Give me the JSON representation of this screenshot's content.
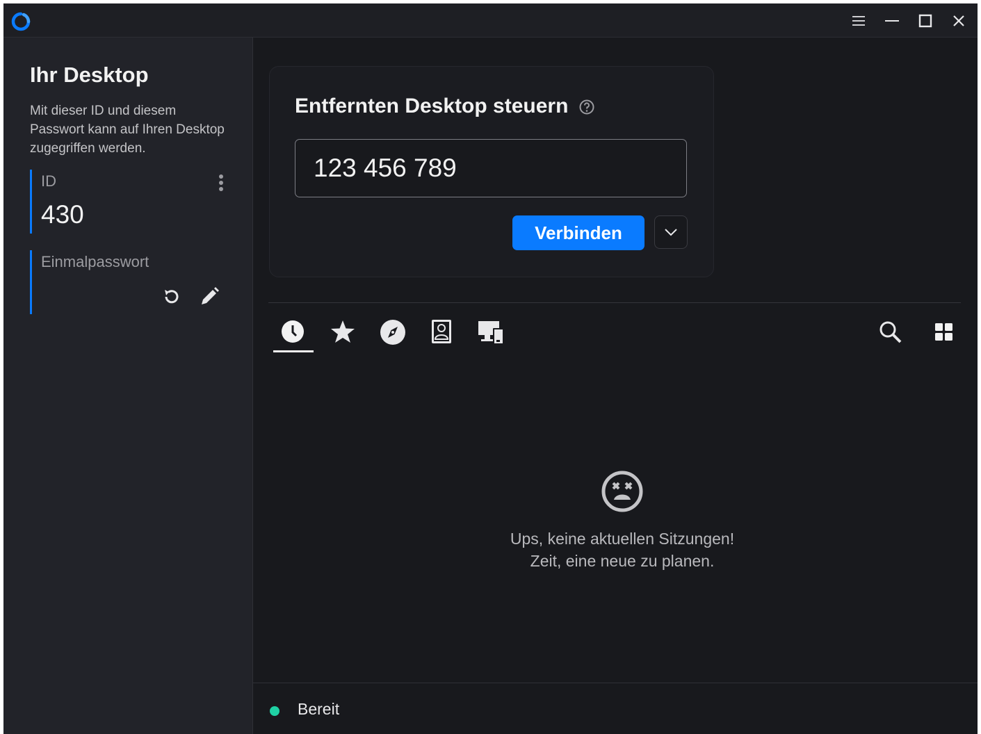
{
  "colors": {
    "accent": "#0a7bff",
    "status_ready": "#1fd1a4",
    "background": "#18191d",
    "sidebar": "#222329"
  },
  "titlebar": {
    "icons": [
      "app-logo-icon",
      "menu-icon",
      "minimize-icon",
      "maximize-icon",
      "close-icon"
    ]
  },
  "sidebar": {
    "title": "Ihr Desktop",
    "description": "Mit dieser ID und diesem Passwort kann auf Ihren Desktop zugegriffen werden.",
    "id_label": "ID",
    "id_value": "430",
    "password_label": "Einmalpasswort"
  },
  "connect": {
    "title": "Entfernten Desktop steuern",
    "input_value": "123 456 789",
    "button_label": "Verbinden"
  },
  "tabs": [
    {
      "name": "recent-sessions",
      "icon": "clock-icon",
      "active": true
    },
    {
      "name": "favorites",
      "icon": "star-icon",
      "active": false
    },
    {
      "name": "discovered",
      "icon": "compass-icon",
      "active": false
    },
    {
      "name": "address-book",
      "icon": "contact-icon",
      "active": false
    },
    {
      "name": "devices",
      "icon": "devices-icon",
      "active": false
    }
  ],
  "empty_state": {
    "line1": "Ups, keine aktuellen Sitzungen!",
    "line2": "Zeit, eine neue zu planen."
  },
  "status": {
    "text": "Bereit"
  }
}
